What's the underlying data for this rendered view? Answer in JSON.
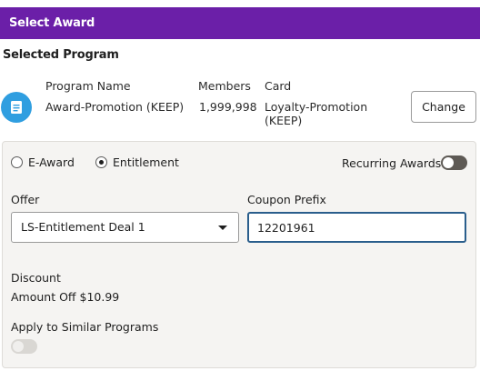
{
  "header": {
    "title": "Select Award"
  },
  "selected_program": {
    "section_title": "Selected Program",
    "icon": "document-icon",
    "columns": {
      "program_name": "Program Name",
      "members": "Members",
      "card": "Card"
    },
    "values": {
      "program_name": "Award-Promotion (KEEP)",
      "members": "1,999,998",
      "card_line1": "Loyalty-Promotion",
      "card_line2": "(KEEP)"
    },
    "change_label": "Change"
  },
  "award_type": {
    "options": [
      {
        "label": "E-Award",
        "checked": false
      },
      {
        "label": "Entitlement",
        "checked": true
      }
    ],
    "recurring_label": "Recurring Awards"
  },
  "offer": {
    "label": "Offer",
    "selected": "LS-Entitlement Deal 1"
  },
  "coupon": {
    "label": "Coupon Prefix",
    "value": "12201961"
  },
  "discount": {
    "label": "Discount",
    "value": "Amount Off $10.99"
  },
  "similar": {
    "label": "Apply to Similar Programs"
  },
  "colors": {
    "header": "#6b1fa8",
    "icon": "#2f9ee0",
    "focus_border": "#2a5e8c"
  }
}
